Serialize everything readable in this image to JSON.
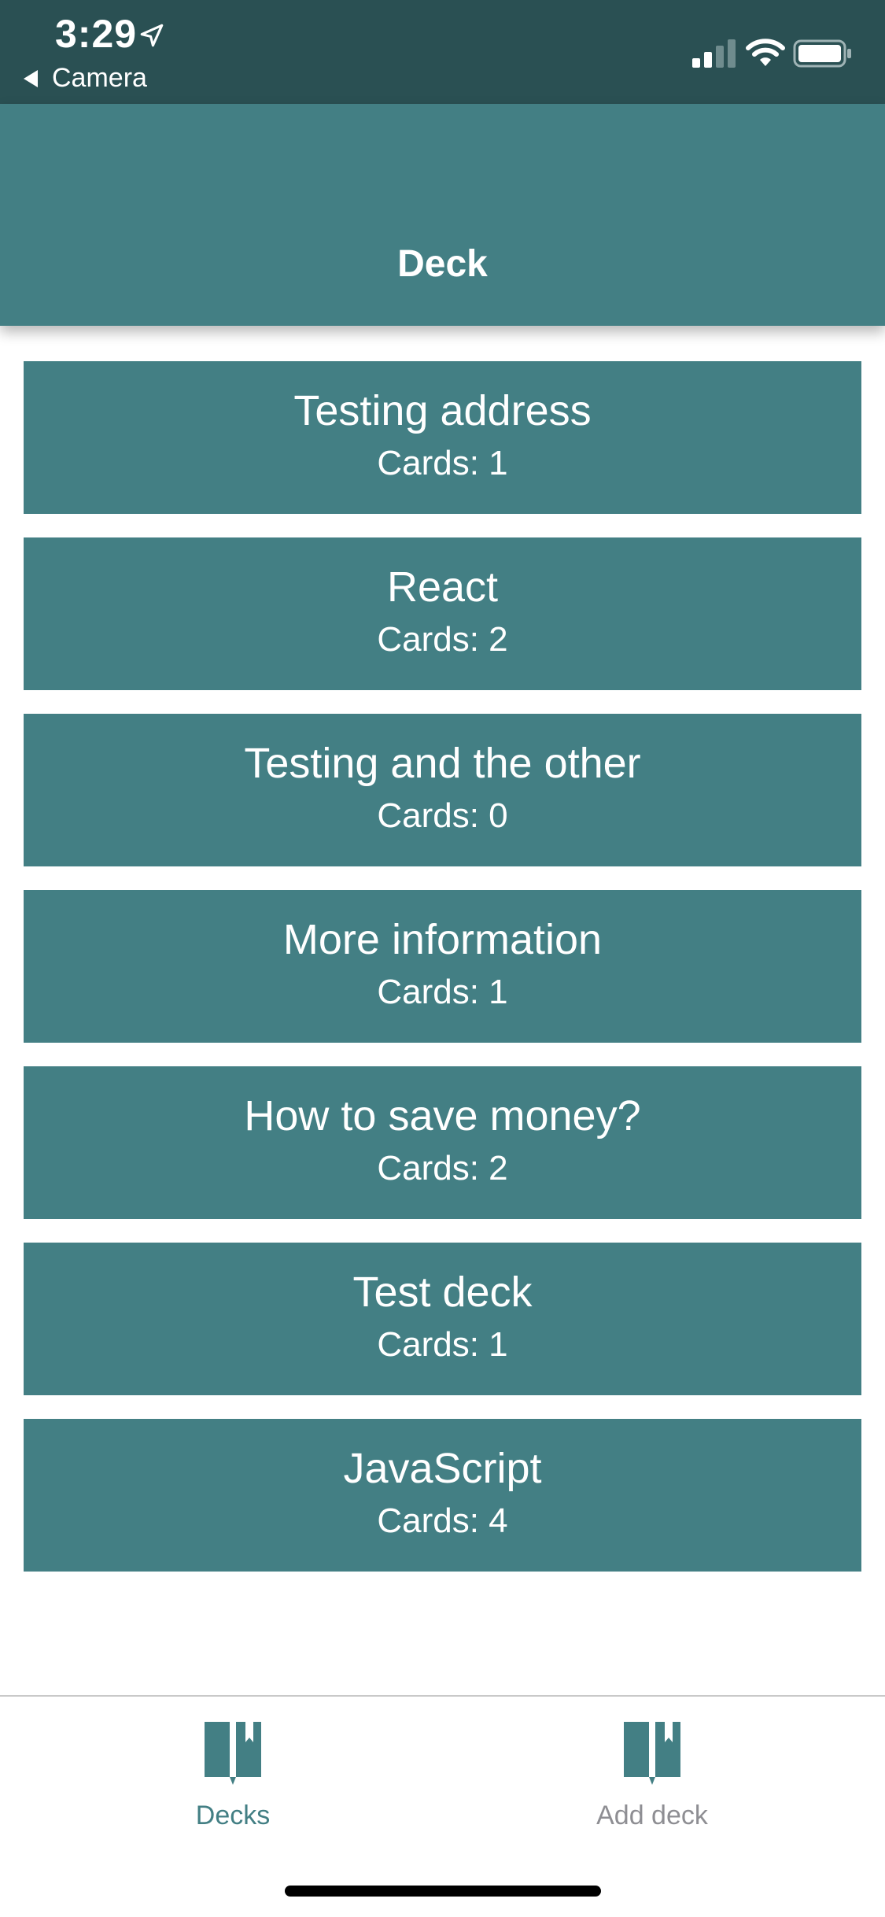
{
  "status_bar": {
    "time": "3:29",
    "back_app": "Camera",
    "icons": [
      "location-arrow-icon",
      "cellular-signal-icon",
      "wifi-icon",
      "battery-icon"
    ]
  },
  "header": {
    "title": "Deck"
  },
  "decks": [
    {
      "title": "Testing address",
      "count": "Cards: 1"
    },
    {
      "title": "React",
      "count": "Cards: 2"
    },
    {
      "title": "Testing and the other",
      "count": "Cards: 0"
    },
    {
      "title": "More information",
      "count": "Cards: 1"
    },
    {
      "title": "How to save money?",
      "count": "Cards: 2"
    },
    {
      "title": "Test deck",
      "count": "Cards: 1"
    },
    {
      "title": "JavaScript",
      "count": "Cards: 4"
    }
  ],
  "tab_bar": {
    "tabs": [
      {
        "label": "Decks",
        "icon": "bookmark-book-icon",
        "active": true
      },
      {
        "label": "Add deck",
        "icon": "bookmark-book-icon",
        "active": false
      }
    ]
  },
  "colors": {
    "status_bar": "#2a5053",
    "primary": "#437f84",
    "inactive_tab": "#8e8e93",
    "background": "#ffffff"
  }
}
